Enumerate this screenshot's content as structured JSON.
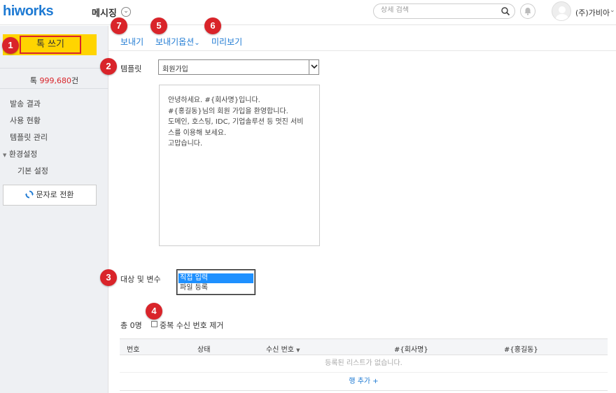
{
  "header": {
    "logo": "hiworks",
    "app_title": "메시징",
    "search_placeholder": "상세 검색",
    "user_name": "(주)가비아"
  },
  "sidebar": {
    "write_button": "톡 쓰기",
    "balance_prefix": "톡 ",
    "balance_value": "999,680",
    "balance_suffix": "건",
    "nav_items": [
      "발송 결과",
      "사용 현황",
      "템플릿 관리"
    ],
    "settings_group": "환경설정",
    "settings_sub": "기본 설정",
    "switch_button": "문자로 전환"
  },
  "tabs": {
    "send": "보내기",
    "send_options": "보내기옵션",
    "preview": "미리보기"
  },
  "template": {
    "label": "템플릿",
    "selected": "회원가입",
    "preview_lines": [
      "안녕하세요. #{회사명}입니다.",
      "#{홍길동}님의 회원 가입을 환영합니다.",
      "도메인, 호스팅, IDC, 기업솔루션 등 멋진 서비",
      "스를 이용해 보세요.",
      "고맙습니다."
    ]
  },
  "target": {
    "label": "대상 및 변수",
    "options": [
      "직접 입력",
      "파일 등록"
    ],
    "selected_index": 0
  },
  "list": {
    "total_count": "총 0명",
    "dedupe_label": "중복 수신 번호 제거",
    "columns": [
      "번호",
      "상태",
      "수신 번호",
      "#{회사명}",
      "#{홍길동}"
    ],
    "empty_text": "등록된 리스트가 없습니다.",
    "add_row": "행 추가 +"
  },
  "badges": [
    "1",
    "2",
    "3",
    "4",
    "5",
    "6",
    "7"
  ],
  "colors": {
    "brand_blue": "#1e7ad3",
    "accent_yellow": "#ffd400",
    "badge_red": "#d9242a",
    "sidebar_bg": "#eef0f3",
    "selection_blue": "#1e90ff"
  }
}
